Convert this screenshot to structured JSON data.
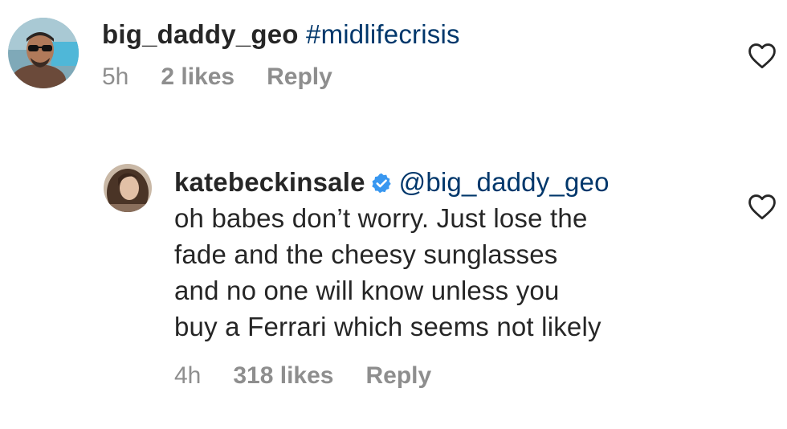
{
  "comments": [
    {
      "username": "big_daddy_geo",
      "hashtag": "#midlifecrisis",
      "time": "5h",
      "likes": "2 likes",
      "reply_label": "Reply"
    },
    {
      "username": "katebeckinsale",
      "mention": "@big_daddy_geo",
      "lines": [
        "oh babes don’t worry. Just lose the",
        "fade and the cheesy sunglasses",
        "and no one will know unless you",
        "buy a Ferrari which seems not likely"
      ],
      "time": "4h",
      "likes": "318 likes",
      "reply_label": "Reply"
    }
  ],
  "icons": {
    "like": "heart-outline-icon",
    "verified": "verified-badge-icon"
  },
  "colors": {
    "text": "#262626",
    "meta": "#8e8e8e",
    "link": "#00376b",
    "verified": "#3897f0"
  }
}
